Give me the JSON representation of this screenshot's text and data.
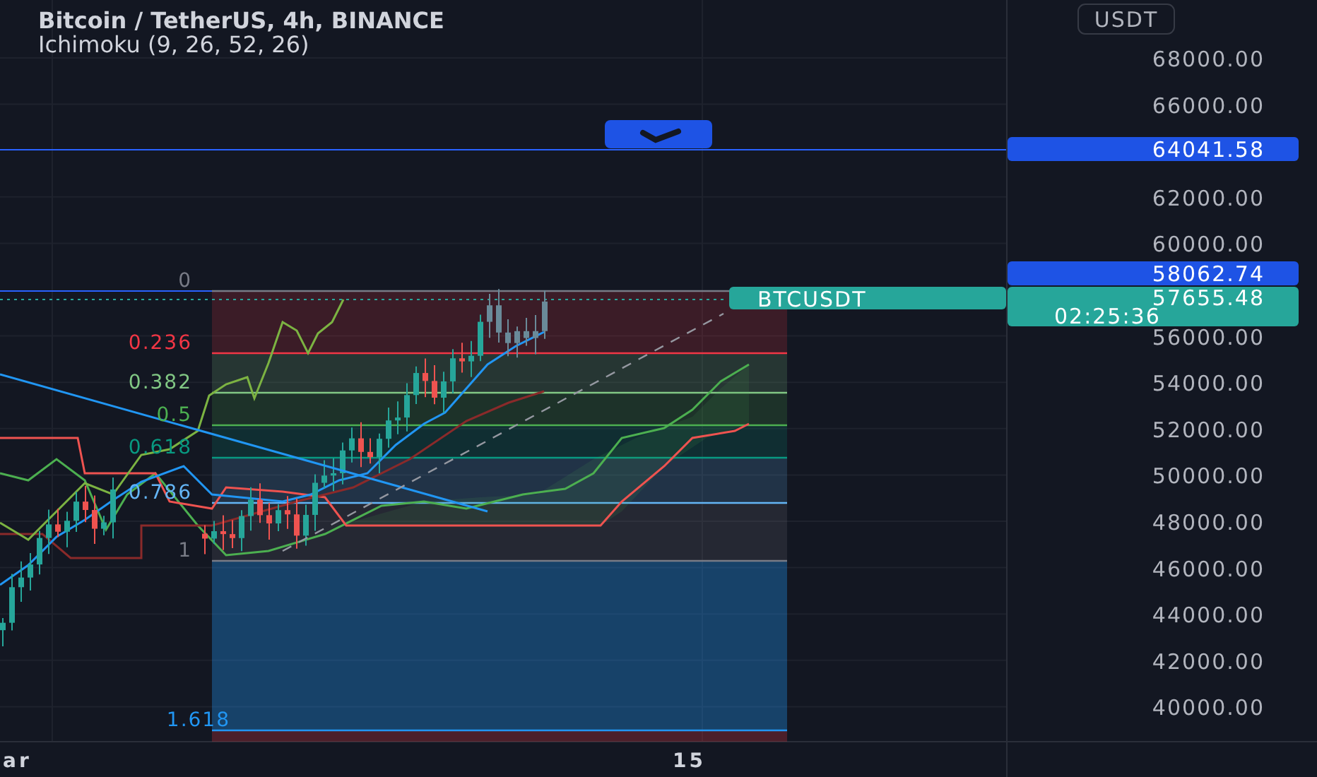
{
  "legend": {
    "title": "Bitcoin / TetherUS, 4h, BINANCE",
    "indicator": "Ichimoku (9, 26, 52, 26)"
  },
  "fib_levels": [
    {
      "label": "0",
      "color": "#787b86"
    },
    {
      "label": "0.236",
      "color": "#f23645"
    },
    {
      "label": "0.382",
      "color": "#81c784"
    },
    {
      "label": "0.5",
      "color": "#4caf50"
    },
    {
      "label": "0.618",
      "color": "#089981"
    },
    {
      "label": "0.786",
      "color": "#64b5f6"
    },
    {
      "label": "1",
      "color": "#787b86"
    },
    {
      "label": "1.618",
      "color": "#2196f3"
    }
  ],
  "symbol_label": "BTCUSDT",
  "price_axis": {
    "currency_button": "USDT",
    "labels": [
      "68000.00",
      "66000.00",
      "62000.00",
      "60000.00",
      "56000.00",
      "54000.00",
      "52000.00",
      "50000.00",
      "48000.00",
      "46000.00",
      "44000.00",
      "42000.00",
      "40000.00"
    ],
    "tags": [
      {
        "kind": "alert",
        "price": "64041.58"
      },
      {
        "kind": "alert",
        "price": "58062.74"
      },
      {
        "kind": "last",
        "price": "57655.48",
        "countdown": "02:25:36"
      }
    ]
  },
  "time_axis": [
    "ar",
    "15"
  ]
}
